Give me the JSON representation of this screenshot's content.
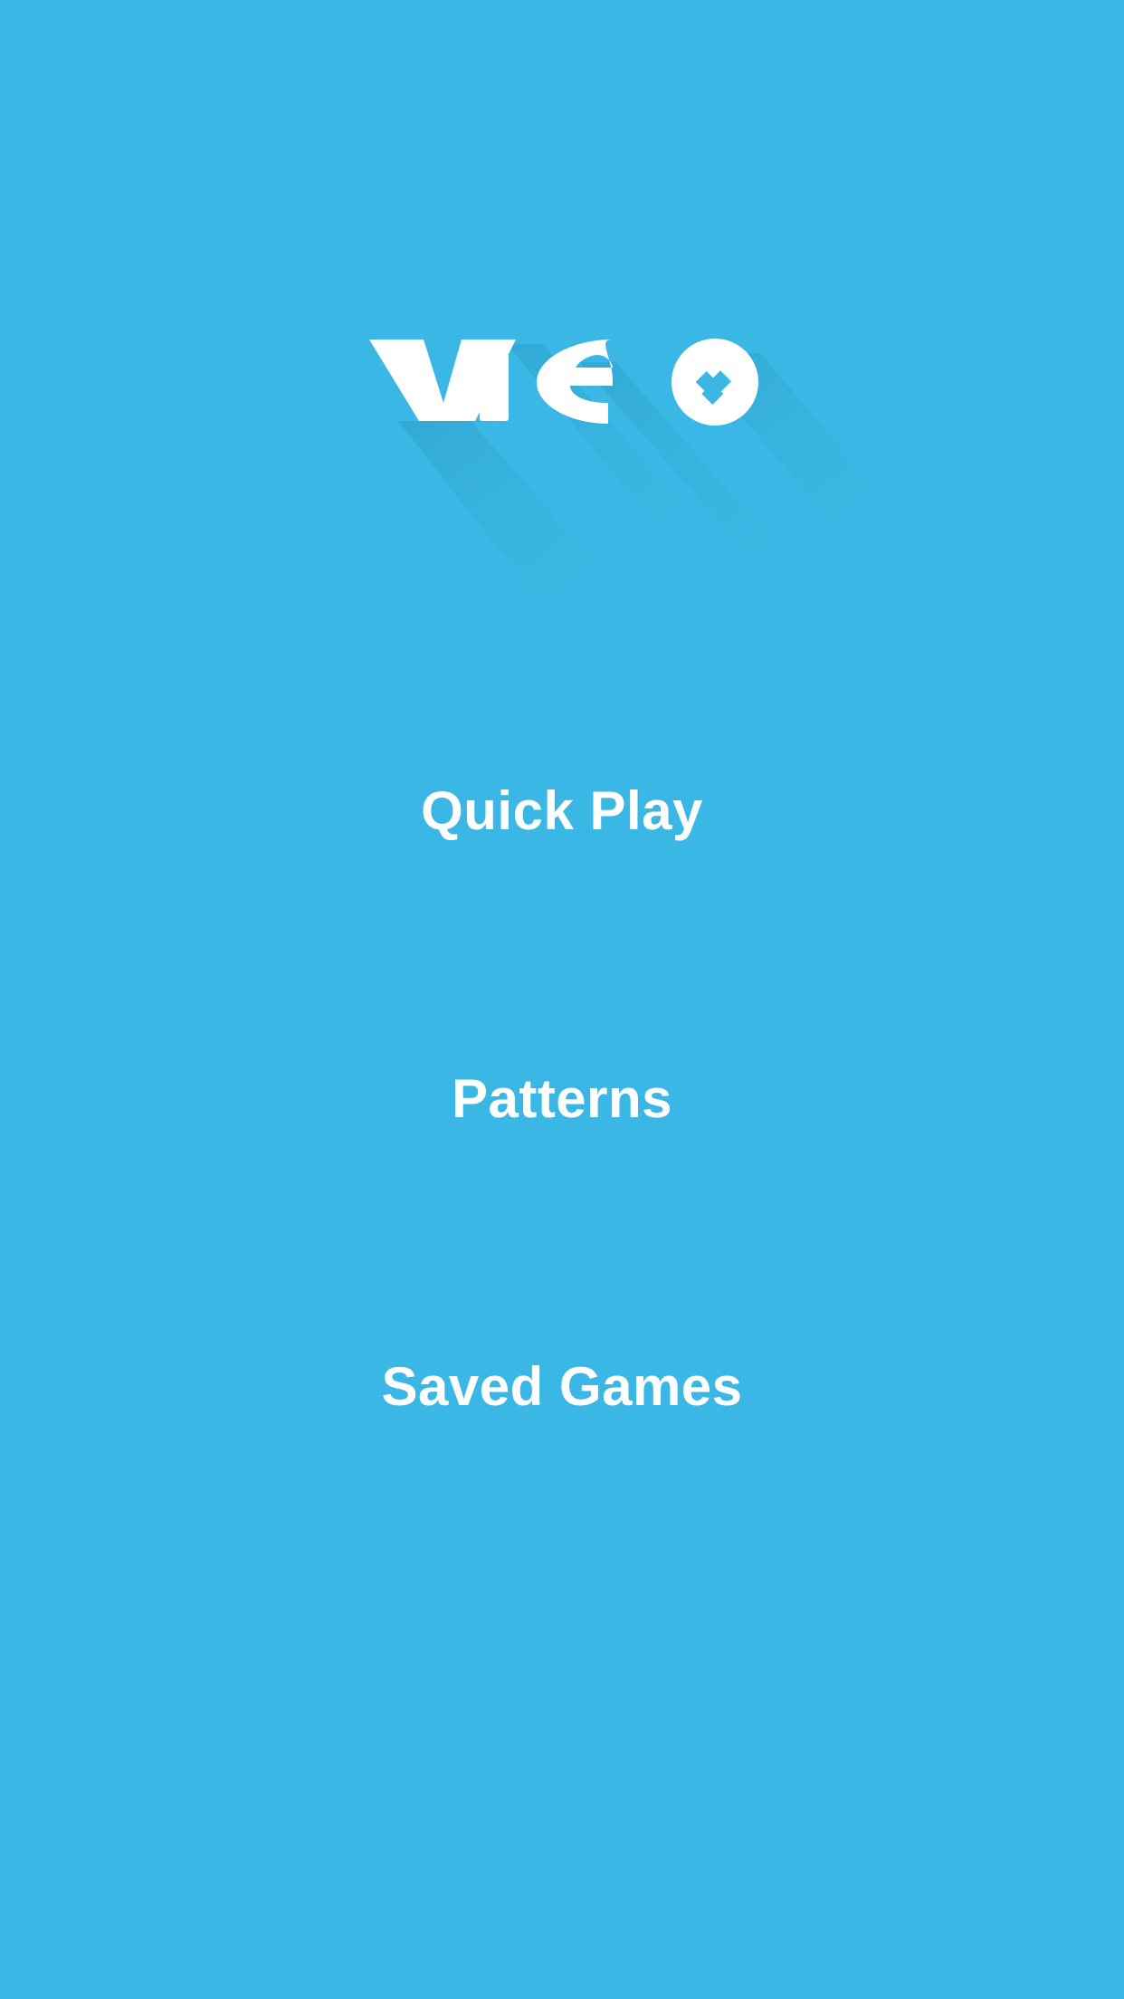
{
  "app": {
    "logo_text": "vie",
    "background_color": "#3ab7e4",
    "foreground_color": "#ffffff",
    "accent_shadow_color": "#2fa3cf",
    "logo_icon": "heart-diamond-icon"
  },
  "menu": {
    "items": [
      {
        "id": "quick-play",
        "label": "Quick Play"
      },
      {
        "id": "patterns",
        "label": "Patterns"
      },
      {
        "id": "saved-games",
        "label": "Saved Games"
      }
    ]
  }
}
